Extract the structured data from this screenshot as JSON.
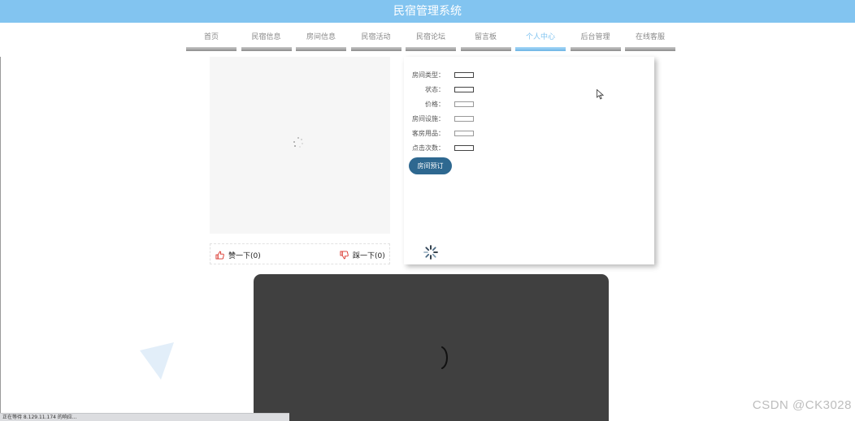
{
  "header": {
    "title": "民宿管理系统"
  },
  "nav": {
    "items": [
      "首页",
      "民宿信息",
      "房间信息",
      "民宿活动",
      "民宿论坛",
      "留言板",
      "个人中心",
      "后台管理",
      "在线客服"
    ],
    "active_index": 6
  },
  "room_detail": {
    "fields": [
      {
        "label": "房间类型："
      },
      {
        "label": "状态："
      },
      {
        "label": "价格："
      },
      {
        "label": "房间设施："
      },
      {
        "label": "客房用品："
      },
      {
        "label": "点击次数："
      }
    ],
    "book_button": "房间预订"
  },
  "votes": {
    "like": "赞一下(0)",
    "dislike": "踩一下(0)"
  },
  "status_bar": {
    "text": "正在等待 8.129.11.174 的响应..."
  },
  "watermark": "CSDN @CK3028",
  "colors": {
    "header_bg": "#82c4f0",
    "accent": "#82c4f0",
    "book_button_bg": "#2e6890",
    "vote_icon": "#d9342b",
    "video_bg": "#404040"
  },
  "icons": {
    "like": "thumbs-up-icon",
    "dislike": "thumbs-down-icon",
    "loading": "spinner-icon",
    "cursor": "mouse-pointer-icon"
  }
}
